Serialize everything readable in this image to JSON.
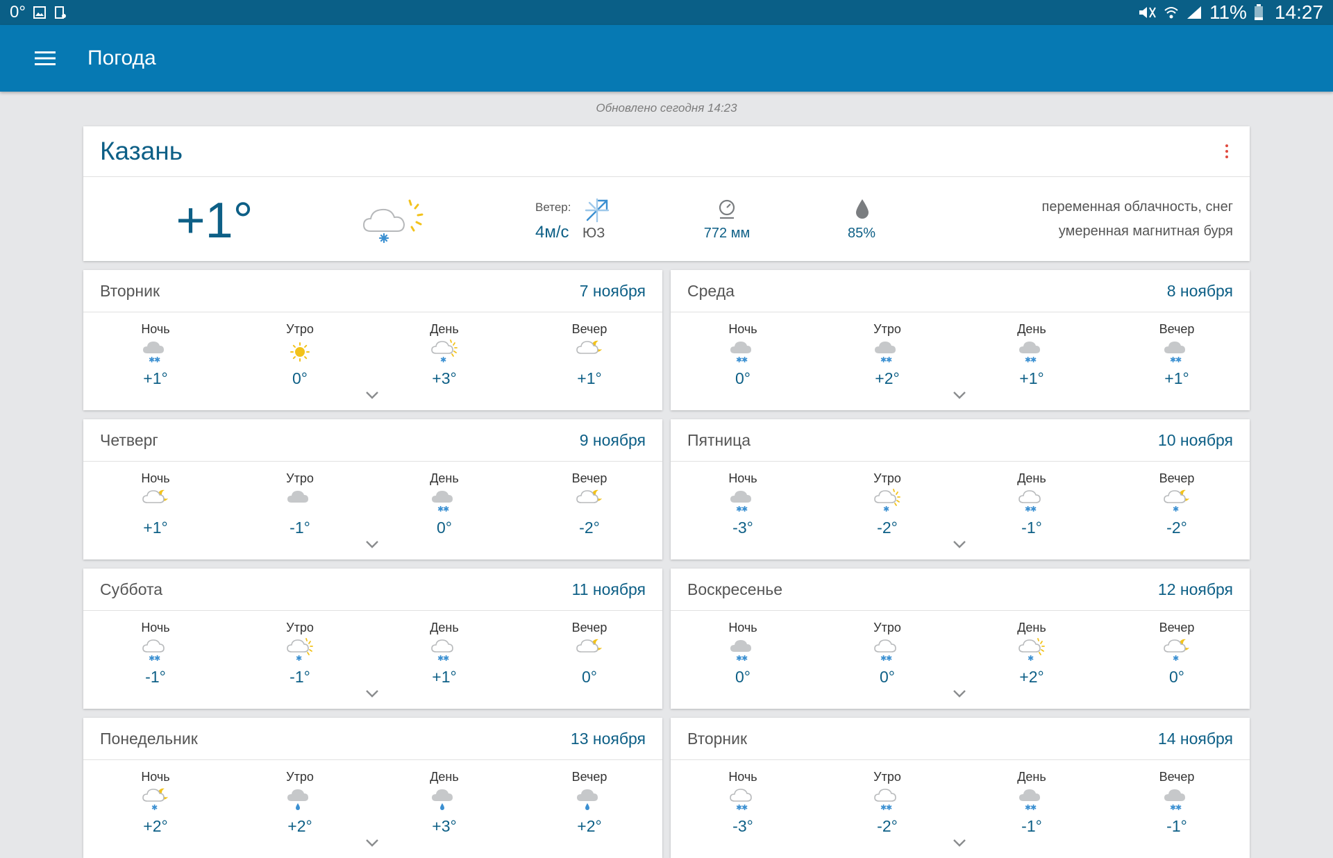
{
  "status_bar": {
    "temp": "0°",
    "battery": "11%",
    "time": "14:27"
  },
  "app_bar": {
    "title": "Погода"
  },
  "updated": "Обновлено сегодня 14:23",
  "current": {
    "city": "Казань",
    "temp": "+1°",
    "icon": "partly-cloudy-snow-icon",
    "wind_label": "Ветер:",
    "wind_speed": "4м/с",
    "wind_dir": "ЮЗ",
    "pressure": "772 мм",
    "humidity": "85%",
    "condition": "переменная облачность, снег",
    "magnetic": "умеренная магнитная буря"
  },
  "days": [
    {
      "name": "Вторник",
      "date": "7 ноября",
      "periods": [
        {
          "label": "Ночь",
          "icon": "snow",
          "temp": "+1°"
        },
        {
          "label": "Утро",
          "icon": "sun",
          "temp": "0°"
        },
        {
          "label": "День",
          "icon": "sun-cloud-snow",
          "temp": "+3°"
        },
        {
          "label": "Вечер",
          "icon": "moon-cloud",
          "temp": "+1°"
        }
      ]
    },
    {
      "name": "Среда",
      "date": "8 ноября",
      "periods": [
        {
          "label": "Ночь",
          "icon": "snow",
          "temp": "0°"
        },
        {
          "label": "Утро",
          "icon": "snow",
          "temp": "+2°"
        },
        {
          "label": "День",
          "icon": "snow",
          "temp": "+1°"
        },
        {
          "label": "Вечер",
          "icon": "snow",
          "temp": "+1°"
        }
      ]
    },
    {
      "name": "Четверг",
      "date": "9 ноября",
      "periods": [
        {
          "label": "Ночь",
          "icon": "moon-cloud",
          "temp": "+1°"
        },
        {
          "label": "Утро",
          "icon": "cloud",
          "temp": "-1°"
        },
        {
          "label": "День",
          "icon": "snow",
          "temp": "0°"
        },
        {
          "label": "Вечер",
          "icon": "moon-cloud",
          "temp": "-2°"
        }
      ]
    },
    {
      "name": "Пятница",
      "date": "10 ноября",
      "periods": [
        {
          "label": "Ночь",
          "icon": "snow",
          "temp": "-3°"
        },
        {
          "label": "Утро",
          "icon": "sun-cloud-snow",
          "temp": "-2°"
        },
        {
          "label": "День",
          "icon": "light-snow",
          "temp": "-1°"
        },
        {
          "label": "Вечер",
          "icon": "moon-cloud-snow",
          "temp": "-2°"
        }
      ]
    },
    {
      "name": "Суббота",
      "date": "11 ноября",
      "periods": [
        {
          "label": "Ночь",
          "icon": "light-snow",
          "temp": "-1°"
        },
        {
          "label": "Утро",
          "icon": "sun-cloud-snow",
          "temp": "-1°"
        },
        {
          "label": "День",
          "icon": "light-snow",
          "temp": "+1°"
        },
        {
          "label": "Вечер",
          "icon": "moon-cloud",
          "temp": "0°"
        }
      ]
    },
    {
      "name": "Воскресенье",
      "date": "12 ноября",
      "periods": [
        {
          "label": "Ночь",
          "icon": "snow",
          "temp": "0°"
        },
        {
          "label": "Утро",
          "icon": "light-snow",
          "temp": "0°"
        },
        {
          "label": "День",
          "icon": "sun-cloud-snow",
          "temp": "+2°"
        },
        {
          "label": "Вечер",
          "icon": "moon-cloud-snow",
          "temp": "0°"
        }
      ]
    },
    {
      "name": "Понедельник",
      "date": "13 ноября",
      "periods": [
        {
          "label": "Ночь",
          "icon": "moon-cloud-snow",
          "temp": "+2°"
        },
        {
          "label": "Утро",
          "icon": "rain",
          "temp": "+2°"
        },
        {
          "label": "День",
          "icon": "rain",
          "temp": "+3°"
        },
        {
          "label": "Вечер",
          "icon": "rain",
          "temp": "+2°"
        }
      ]
    },
    {
      "name": "Вторник",
      "date": "14 ноября",
      "periods": [
        {
          "label": "Ночь",
          "icon": "light-snow",
          "temp": "-3°"
        },
        {
          "label": "Утро",
          "icon": "light-snow",
          "temp": "-2°"
        },
        {
          "label": "День",
          "icon": "snow",
          "temp": "-1°"
        },
        {
          "label": "Вечер",
          "icon": "snow",
          "temp": "-1°"
        }
      ]
    }
  ],
  "colors": {
    "primary": "#0679b3",
    "status_bar": "#0a5f87",
    "accent_text": "#0d5f86",
    "menu_dots": "#e0493e"
  }
}
